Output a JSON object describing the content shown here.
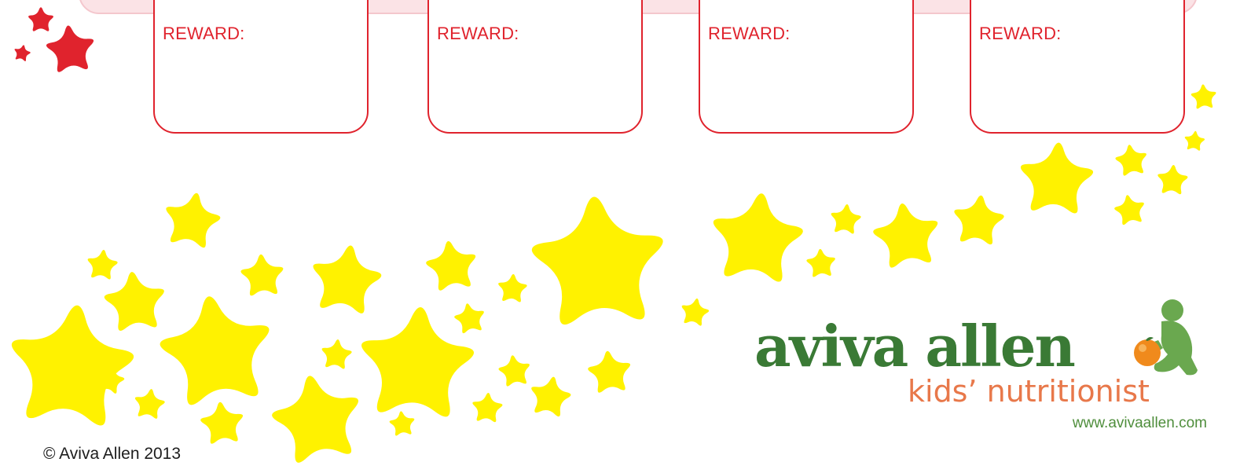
{
  "reward_boxes": [
    {
      "label": "REWARD:"
    },
    {
      "label": "REWARD:"
    },
    {
      "label": "REWARD:"
    },
    {
      "label": "REWARD:"
    }
  ],
  "logo": {
    "brand": "aviva allen",
    "tagline": "kids’ nutritionist",
    "url": "www.avivaallen.com",
    "icons": [
      "child-with-orange-icon"
    ]
  },
  "footer": {
    "copyright": "© Aviva Allen 2013"
  },
  "colors": {
    "reward_red": "#e0232d",
    "star_yellow": "#fff200",
    "brand_green": "#3a7a35",
    "tagline_orange": "#e8784a"
  }
}
